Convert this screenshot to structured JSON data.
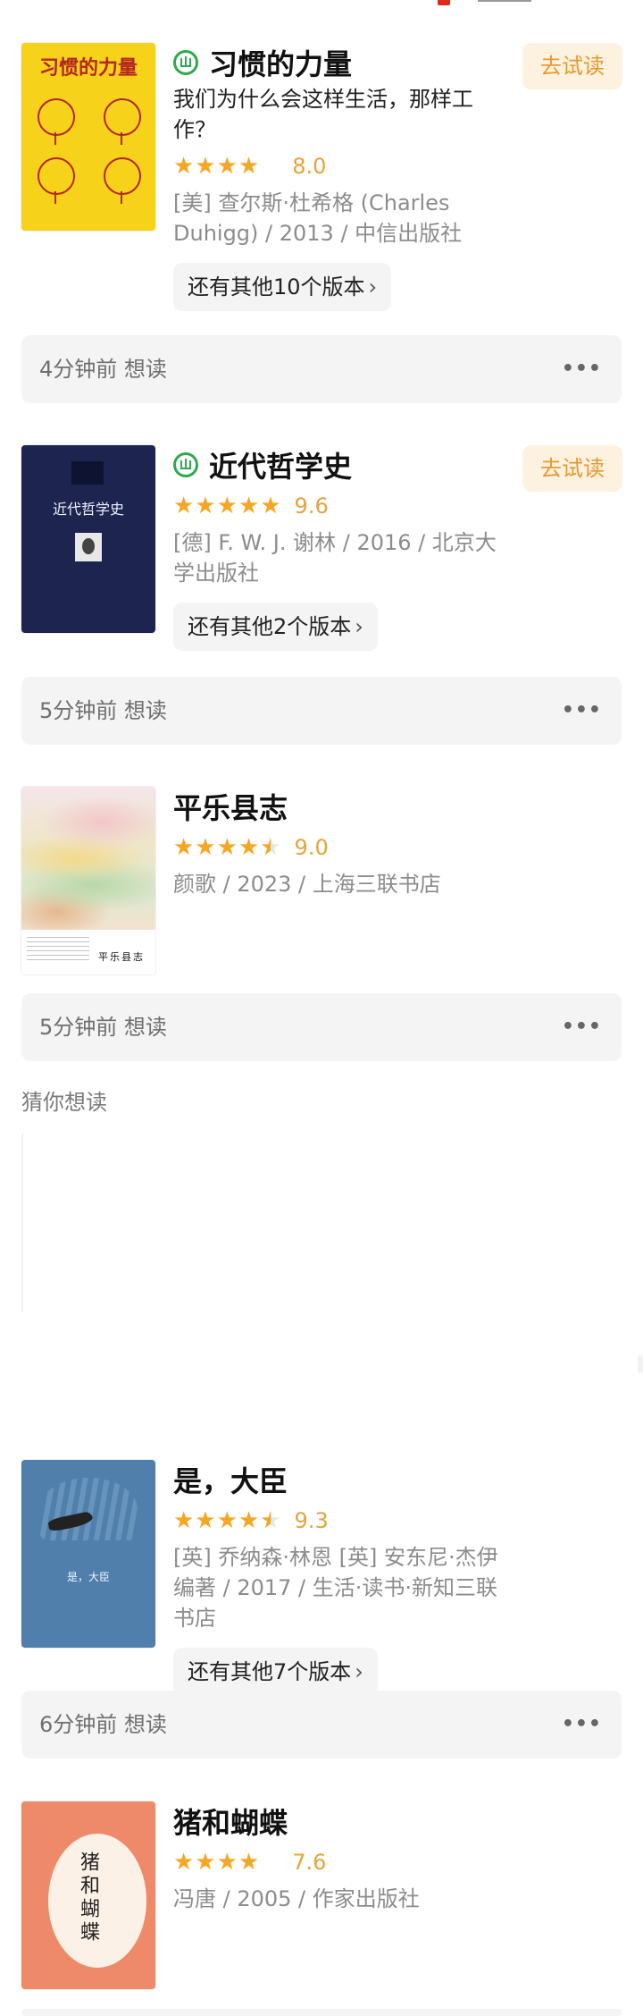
{
  "header": {
    "partial": true
  },
  "books": [
    {
      "title": "习惯的力量",
      "subtitle": "我们为什么会这样生活，那样工作？",
      "stars": "★★★★",
      "rating": "8.0",
      "meta": "[美] 查尔斯·杜希格 (Charles Duhigg) / 2013 / 中信出版社",
      "versions": "还有其他10个版本",
      "try_label": "去试读",
      "ebook": true,
      "status": "4分钟前 想读",
      "cover_title": "习惯的力量"
    },
    {
      "title": "近代哲学史",
      "subtitle": "",
      "stars": "★★★★★",
      "rating": "9.6",
      "meta": "[德] F. W. J. 谢林 / 2016 / 北京大学出版社",
      "versions": "还有其他2个版本",
      "try_label": "去试读",
      "ebook": true,
      "status": "5分钟前 想读",
      "cover_title": "近代哲学史"
    },
    {
      "title": "平乐县志",
      "subtitle": "",
      "stars": "★★★★",
      "rating": "9.0",
      "meta": "颜歌 / 2023 / 上海三联书店",
      "versions": "",
      "try_label": "",
      "ebook": false,
      "status": "5分钟前 想读",
      "cover_title": "平乐县志"
    },
    {
      "title": "是，大臣",
      "subtitle": "",
      "stars": "★★★★",
      "rating": "9.3",
      "meta": "[英] 乔纳森·林恩 [英] 安东尼·杰伊 编著 / 2017 / 生活·读书·新知三联书店",
      "versions": "还有其他7个版本",
      "try_label": "",
      "ebook": false,
      "status": "6分钟前 想读",
      "cover_title": "是，大臣"
    },
    {
      "title": "猪和蝴蝶",
      "subtitle": "",
      "stars": "★★★★",
      "rating": "7.6",
      "meta": "冯唐 / 2005 / 作家出版社",
      "versions": "",
      "try_label": "",
      "ebook": false,
      "status": "",
      "cover_title": "猪和蝴蝶"
    }
  ],
  "section_label": "猜你想读",
  "more_glyph": "•••",
  "chevron_glyph": "›",
  "colors": {
    "star": "#f5a623",
    "score": "#e8a33a",
    "try_bg": "#fdf1df",
    "try_text": "#e59a2d",
    "ebook_green": "#2fa84f"
  }
}
